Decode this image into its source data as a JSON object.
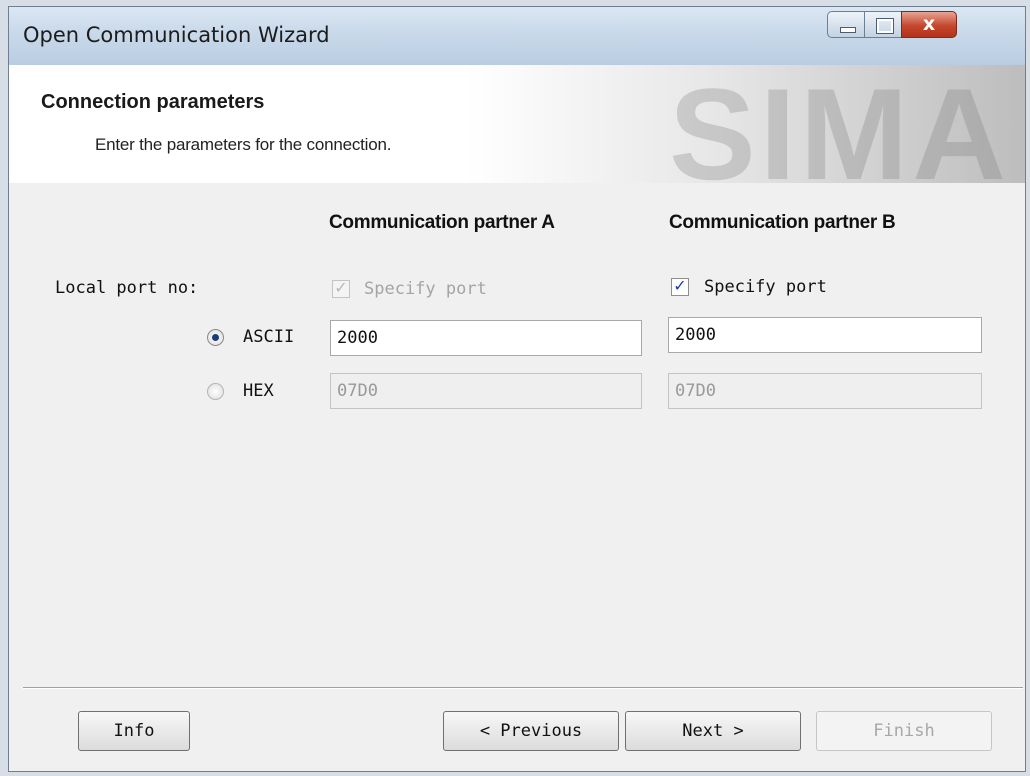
{
  "window": {
    "title": "Open Communication Wizard",
    "close_glyph": "x",
    "controls": [
      "minimize-icon",
      "maximize-icon",
      "close-icon"
    ]
  },
  "header": {
    "title": "Connection parameters",
    "subtitle": "Enter the parameters for the connection.",
    "brand": "SIMA"
  },
  "columns": {
    "partner_a": "Communication partner A",
    "partner_b": "Communication partner B"
  },
  "port": {
    "label": "Local port no:",
    "partner_a": {
      "specify_label": "Specify port",
      "specify_checked": true,
      "specify_enabled": false,
      "ascii_value": "2000",
      "hex_value": "07D0"
    },
    "partner_b": {
      "specify_label": "Specify port",
      "specify_checked": true,
      "specify_enabled": true,
      "ascii_value": "2000",
      "hex_value": "07D0"
    }
  },
  "format": {
    "ascii_label": "ASCII",
    "hex_label": "HEX",
    "selected": "ASCII"
  },
  "buttons": {
    "info": "Info",
    "previous": "< Previous",
    "next": "Next >",
    "finish": "Finish"
  },
  "colors": {
    "check_accent": "#1c3f9b",
    "close_button": "#c4472d"
  }
}
